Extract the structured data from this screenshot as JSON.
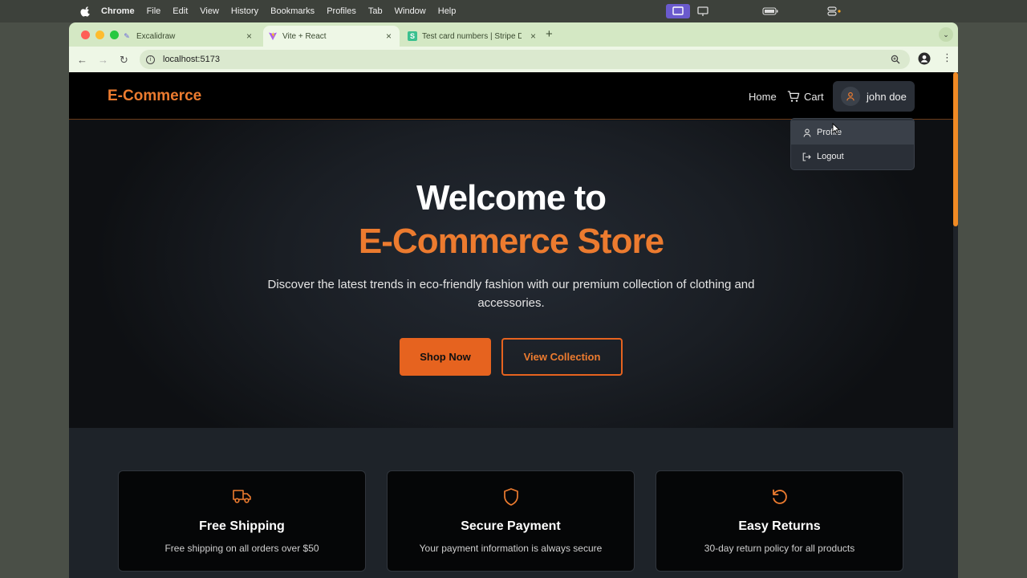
{
  "menubar": {
    "app": "Chrome",
    "items": [
      "File",
      "Edit",
      "View",
      "History",
      "Bookmarks",
      "Profiles",
      "Tab",
      "Window",
      "Help"
    ]
  },
  "browser": {
    "tabs": [
      {
        "title": "Excalidraw",
        "icon": "excalidraw-icon",
        "active": false
      },
      {
        "title": "Vite + React",
        "icon": "vite-icon",
        "active": true
      },
      {
        "title": "Test card numbers | Stripe Do",
        "icon": "stripe-icon",
        "active": false
      }
    ],
    "url": "localhost:5173"
  },
  "site": {
    "logo": "E-Commerce",
    "nav": {
      "home": "Home",
      "cart": "Cart",
      "user": "john doe"
    },
    "dropdown": {
      "profile": "Profile",
      "logout": "Logout"
    },
    "hero": {
      "title_line1": "Welcome to",
      "title_line2": "E-Commerce Store",
      "subtitle": "Discover the latest trends in eco-friendly fashion with our premium collection of clothing and accessories.",
      "primary_button": "Shop Now",
      "secondary_button": "View Collection"
    },
    "features": [
      {
        "title": "Free Shipping",
        "desc": "Free shipping on all orders over $50",
        "icon": "truck-icon"
      },
      {
        "title": "Secure Payment",
        "desc": "Your payment information is always secure",
        "icon": "shield-icon"
      },
      {
        "title": "Easy Returns",
        "desc": "30-day return policy for all products",
        "icon": "rotate-icon"
      }
    ],
    "colors": {
      "accent": "#ec7b2f",
      "button": "#e6631f",
      "background": "#101318"
    }
  }
}
